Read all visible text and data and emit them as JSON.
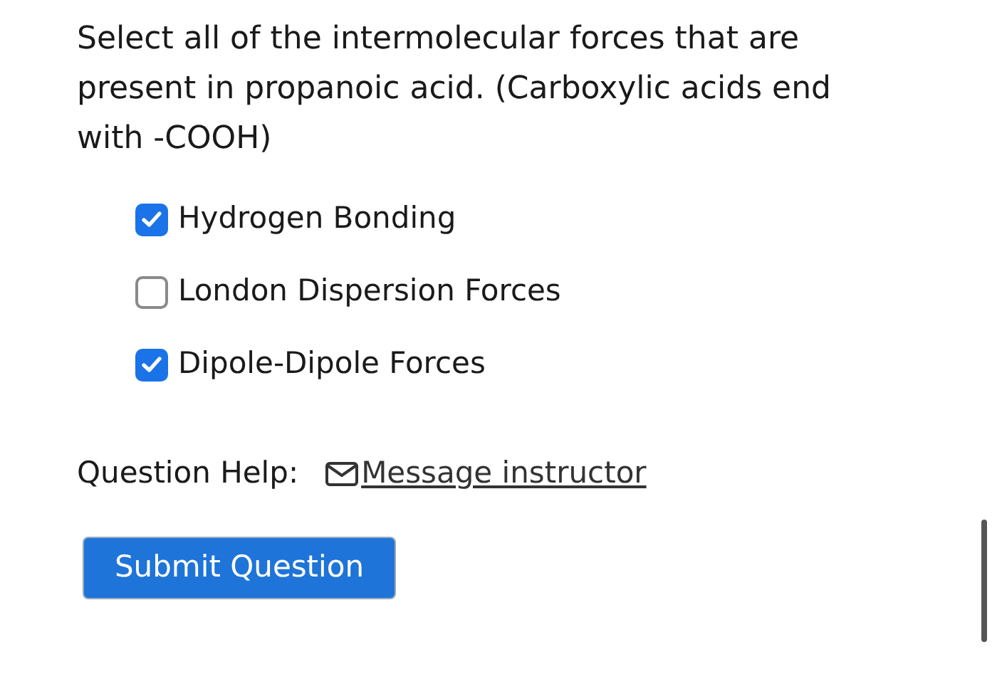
{
  "question": "Select all of the intermolecular forces that are present in propanoic acid. (Carboxylic acids end with -COOH)",
  "options": [
    {
      "label": "Hydrogen Bonding",
      "checked": true
    },
    {
      "label": "London Dispersion Forces",
      "checked": false
    },
    {
      "label": "Dipole-Dipole Forces",
      "checked": true
    }
  ],
  "help": {
    "label": "Question Help:",
    "link": "Message instructor"
  },
  "submit": "Submit Question"
}
